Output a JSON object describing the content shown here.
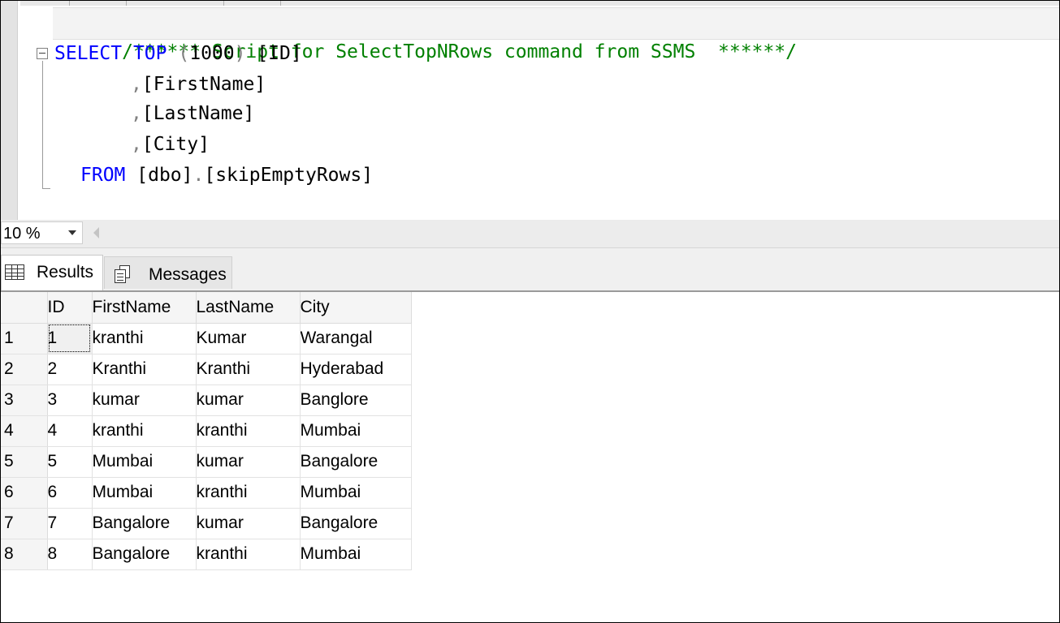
{
  "editor": {
    "line_comment": "/****** Script for SelectTopNRows command from SSMS  ******/",
    "kw_select": "SELECT",
    "kw_top": "TOP",
    "paren_open": "(",
    "top_count": "1000",
    "paren_close": ")",
    "col_id": "[ID]",
    "comma": ",",
    "col_firstname": "[FirstName]",
    "col_lastname": "[LastName]",
    "col_city": "[City]",
    "kw_from": "FROM",
    "schema": "[dbo]",
    "dot": ".",
    "table_name": "[skipEmptyRows]"
  },
  "zoom": {
    "value": "10 %"
  },
  "tabs": {
    "results_label": "Results",
    "messages_label": "Messages"
  },
  "grid": {
    "columns": [
      "ID",
      "FirstName",
      "LastName",
      "City"
    ],
    "rows": [
      {
        "rownum": "1",
        "id": "1",
        "first": "kranthi",
        "last": "Kumar",
        "city": "Warangal"
      },
      {
        "rownum": "2",
        "id": "2",
        "first": "Kranthi",
        "last": "Kranthi",
        "city": "Hyderabad"
      },
      {
        "rownum": "3",
        "id": "3",
        "first": "kumar",
        "last": "kumar",
        "city": "Banglore"
      },
      {
        "rownum": "4",
        "id": "4",
        "first": "kranthi",
        "last": "kranthi",
        "city": "Mumbai"
      },
      {
        "rownum": "5",
        "id": "5",
        "first": "Mumbai",
        "last": "kumar",
        "city": "Bangalore"
      },
      {
        "rownum": "6",
        "id": "6",
        "first": "Mumbai",
        "last": "kranthi",
        "city": "Mumbai"
      },
      {
        "rownum": "7",
        "id": "7",
        "first": "Bangalore",
        "last": "kumar",
        "city": "Bangalore"
      },
      {
        "rownum": "8",
        "id": "8",
        "first": "Bangalore",
        "last": "kranthi",
        "city": "Mumbai"
      }
    ]
  },
  "colors": {
    "keyword": "#0000ff",
    "comment": "#008000",
    "operator": "#808080",
    "text": "#000000"
  }
}
